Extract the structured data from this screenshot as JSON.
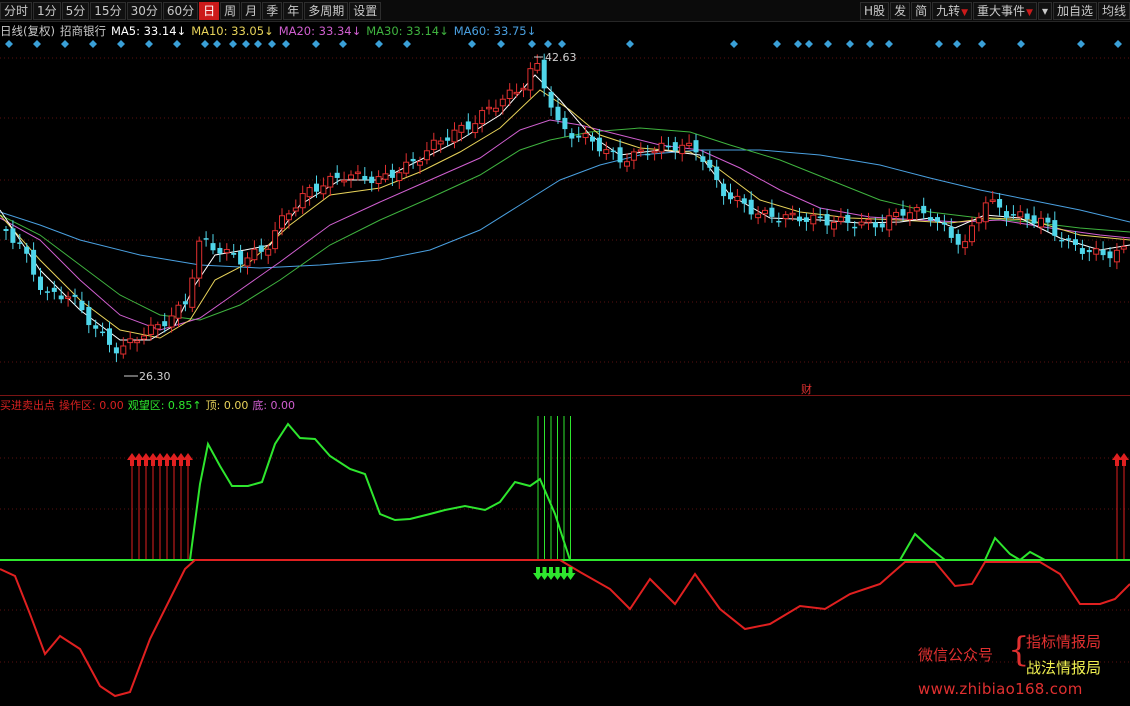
{
  "toolbar": {
    "periods": [
      "分时",
      "1分",
      "5分",
      "15分",
      "30分",
      "60分",
      "日",
      "周",
      "月",
      "季",
      "年",
      "多周期",
      "设置"
    ],
    "active_period": "日",
    "right_buttons": [
      "H股",
      "发",
      "简",
      "九转",
      "重大事件",
      "加自选",
      "均线"
    ]
  },
  "legend": {
    "period_label": "日线(复权)",
    "stock_name": "招商银行",
    "ma5": "MA5: 33.14↓",
    "ma10": "MA10: 33.05↓",
    "ma20": "MA20: 33.34↓",
    "ma30": "MA30: 33.14↓",
    "ma60": "MA60: 33.75↓"
  },
  "price_chart": {
    "high_label": "42.63",
    "low_label": "26.30",
    "event_marker": "财"
  },
  "indicator": {
    "name": "买进卖出点",
    "op_zone": "操作区: 0.00",
    "watch_zone": "观望区: 0.85↑",
    "top": "顶: 0.00",
    "bottom": "底: 0.00"
  },
  "watermark": {
    "wechat": "微信公众号",
    "brand1": "指标情报局",
    "brand2": "战法情报局",
    "url": "www.zhibiao168.com"
  },
  "colors": {
    "up": "#e03030",
    "down": "#4fd6ea",
    "ma5": "#ffffff",
    "ma10": "#e8d35a",
    "ma20": "#d05fd0",
    "ma30": "#3fb33f",
    "ma60": "#4aa0e0",
    "event_diamond": "#3aa0d8",
    "signal_green": "#2ee62e",
    "signal_red": "#e02020"
  }
}
